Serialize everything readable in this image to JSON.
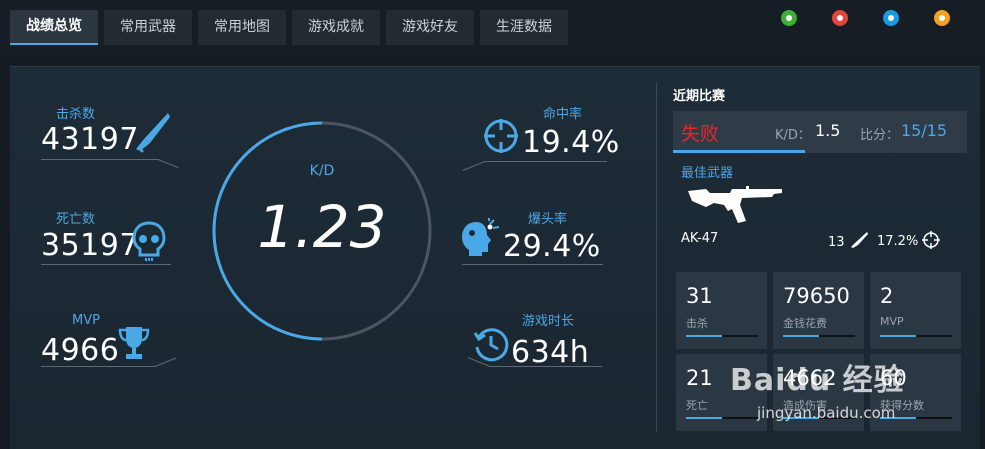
{
  "tabs": [
    {
      "label": "战绩总览",
      "active": true
    },
    {
      "label": "常用武器",
      "active": false
    },
    {
      "label": "常用地图",
      "active": false
    },
    {
      "label": "游戏成就",
      "active": false
    },
    {
      "label": "游戏好友",
      "active": false
    },
    {
      "label": "生涯数据",
      "active": false
    }
  ],
  "share_icons": [
    {
      "name": "wechat-icon",
      "color": "#3cb034"
    },
    {
      "name": "weibo-icon",
      "color": "#e0473a"
    },
    {
      "name": "qq-icon",
      "color": "#1a9ae0"
    },
    {
      "name": "qzone-icon",
      "color": "#f2a21c"
    }
  ],
  "overview": {
    "kills": {
      "label": "击杀数",
      "value": "43197"
    },
    "deaths": {
      "label": "死亡数",
      "value": "35197"
    },
    "mvp": {
      "label": "MVP",
      "value": "4966"
    },
    "accuracy": {
      "label": "命中率",
      "value": "19.4%"
    },
    "headshot": {
      "label": "爆头率",
      "value": "29.4%"
    },
    "playtime": {
      "label": "游戏时长",
      "value": "634h"
    },
    "kd": {
      "label": "K/D",
      "value": "1.23"
    }
  },
  "recent": {
    "title": "近期比赛",
    "result": "失败",
    "kd_label": "K/D：",
    "kd_value": "1.5",
    "score_label": "比分：",
    "score_value": "15/15",
    "best_weapon_title": "最佳武器",
    "weapon_name": "AK-47",
    "weapon_kills": "13",
    "weapon_headshot": "17.2%"
  },
  "cards": [
    {
      "value": "31",
      "caption": "击杀",
      "fill": 0.5
    },
    {
      "value": "79650",
      "caption": "金钱花费",
      "fill": 0.5
    },
    {
      "value": "2",
      "caption": "MVP",
      "fill": 0.5
    },
    {
      "value": "21",
      "caption": "死亡",
      "fill": 0.5
    },
    {
      "value": "4662",
      "caption": "造成伤害",
      "fill": 0.5
    },
    {
      "value": "60",
      "caption": "获得分数",
      "fill": 0.5
    }
  ],
  "watermark": {
    "main": "Baidu 经验",
    "sub": "jingyan.baidu.com"
  },
  "colors": {
    "accent": "#4aa8e6",
    "loss": "#e8252f",
    "panel": "#1e2c38"
  }
}
